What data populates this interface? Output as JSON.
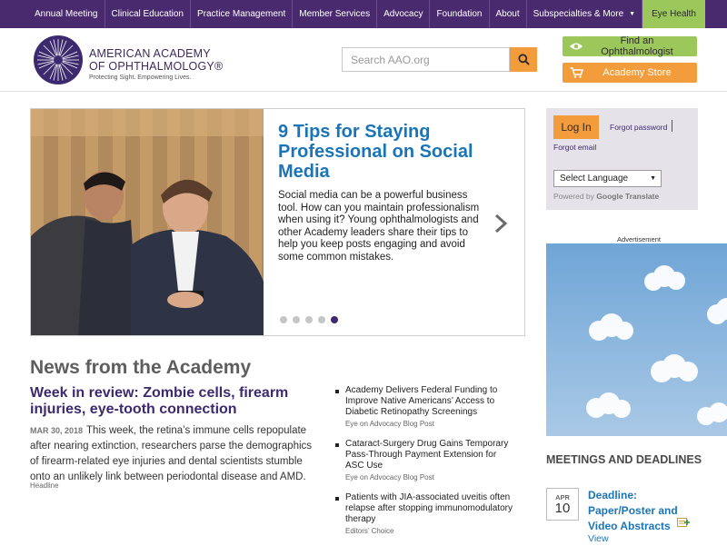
{
  "topnav": {
    "items": [
      {
        "label": "Annual Meeting"
      },
      {
        "label": "Clinical Education"
      },
      {
        "label": "Practice Management"
      },
      {
        "label": "Member Services"
      },
      {
        "label": "Advocacy"
      },
      {
        "label": "Foundation"
      },
      {
        "label": "About"
      },
      {
        "label": "Subspecialties & More",
        "caret": "▼"
      }
    ],
    "eye_health": "Eye Health"
  },
  "header": {
    "logo_line1": "AMERICAN ACADEMY",
    "logo_line2": "OF OPHTHALMOLOGY®",
    "tagline": "Protecting Sight. Empowering Lives.",
    "search_placeholder": "Search AAO.org",
    "find_label": "Find an Ophthalmologist",
    "store_label": "Academy Store"
  },
  "hero": {
    "title": "9 Tips for Staying Professional on Social Media",
    "body": "Social media can be a powerful business tool. How can you maintain professionalism when using it? Young ophthalmologists and other Academy leaders share their tips to help you keep posts engaging and avoid some common mistakes.",
    "slide_count": 5,
    "active_slide": 5
  },
  "news": {
    "heading": "News from the Academy",
    "feature": {
      "title": "Week in review: Zombie cells, firearm injuries, eye-tooth connection",
      "date": "MAR 30, 2018",
      "body": "This week, the retina’s immune cells repopulate after nearing extinction, researchers parse the demographics of firearm-related eye injuries and dental scientists stumble onto an unlikely link between periodontal disease and AMD.",
      "type": "Headline"
    },
    "items": [
      {
        "title": "Academy Delivers Federal Funding to Improve Native Americans’ Access to Diabetic Retinopathy Screenings",
        "type": "Eye on Advocacy Blog Post"
      },
      {
        "title": "Cataract-Surgery Drug Gains Temporary Pass-Through Payment Extension for ASC Use",
        "type": "Eye on Advocacy Blog Post"
      },
      {
        "title": "Patients with JIA-associated uveitis often relapse after stopping immunomodulatory therapy",
        "type": "Editors’ Choice"
      }
    ]
  },
  "login": {
    "button": "Log In",
    "forgot_password": "Forgot password",
    "forgot_email": "Forgot email",
    "language": "Select Language",
    "powered_prefix": "Powered by",
    "powered_brand": "Google Translate"
  },
  "ad": {
    "label": "Advertisement"
  },
  "meetings": {
    "heading": "MEETINGS AND DEADLINES",
    "event": {
      "month": "APR",
      "day": "10",
      "title": "Deadline: Paper/Poster and Video Abstracts",
      "view": "View"
    }
  },
  "colors": {
    "nav_bg": "#4a2a6e",
    "accent_green": "#9cc75a",
    "accent_orange": "#f39c3b",
    "link_blue": "#1a75b8",
    "brand_purple": "#3d2a6e"
  }
}
